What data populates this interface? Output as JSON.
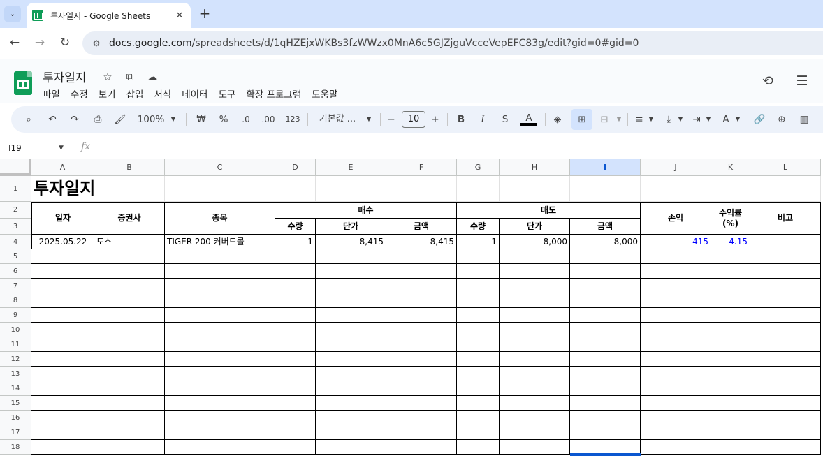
{
  "browser": {
    "tab_title": "투자일지 - Google Sheets",
    "url_host": "docs.google.com",
    "url_path": "/spreadsheets/d/1qHZEjxWKBs3fzWWzx0MnA6c5GJZjguVcceVepEFC83g/edit?gid=0#gid=0"
  },
  "doc": {
    "title": "투자일지",
    "menu": [
      "파일",
      "수정",
      "보기",
      "삽입",
      "서식",
      "데이터",
      "도구",
      "확장 프로그램",
      "도움말"
    ]
  },
  "toolbar": {
    "zoom": "100%",
    "currency": "₩",
    "percent": "%",
    "dec_decrease": ".0",
    "dec_increase": ".00",
    "number_format": "123",
    "font": "기본값 ...",
    "font_size": "10"
  },
  "formula_bar": {
    "name_box": "I19",
    "fx_label": "fx"
  },
  "grid": {
    "columns": [
      "A",
      "B",
      "C",
      "D",
      "E",
      "F",
      "G",
      "H",
      "I",
      "J",
      "K",
      "L"
    ],
    "selected_column": "I",
    "rows": [
      "1",
      "2",
      "3",
      "4",
      "5",
      "6",
      "7",
      "8",
      "9",
      "10",
      "11",
      "12",
      "13",
      "14",
      "15",
      "16",
      "17",
      "18"
    ],
    "title": "투자일지",
    "headers": {
      "date": "일자",
      "broker": "증권사",
      "stock": "종목",
      "buy": "매수",
      "sell": "매도",
      "pnl": "손익",
      "return_rate": "수익률 (%)",
      "note": "비고",
      "buy_qty": "수량",
      "buy_price": "단가",
      "buy_amount": "금액",
      "sell_qty": "수량",
      "sell_price": "단가",
      "sell_amount": "금액"
    },
    "record": {
      "date": "2025.05.22",
      "broker": "토스",
      "stock": "TIGER 200 커버드콜",
      "buy_qty": "1",
      "buy_price": "8,415",
      "buy_amount": "8,415",
      "sell_qty": "1",
      "sell_price": "8,000",
      "sell_amount": "8,000",
      "pnl": "-415",
      "return_rate": "-4.15",
      "note": ""
    }
  },
  "colors": {
    "negative_text": "#0000ff",
    "selection": "#0b57d0",
    "sheets_green": "#0f9d58"
  }
}
